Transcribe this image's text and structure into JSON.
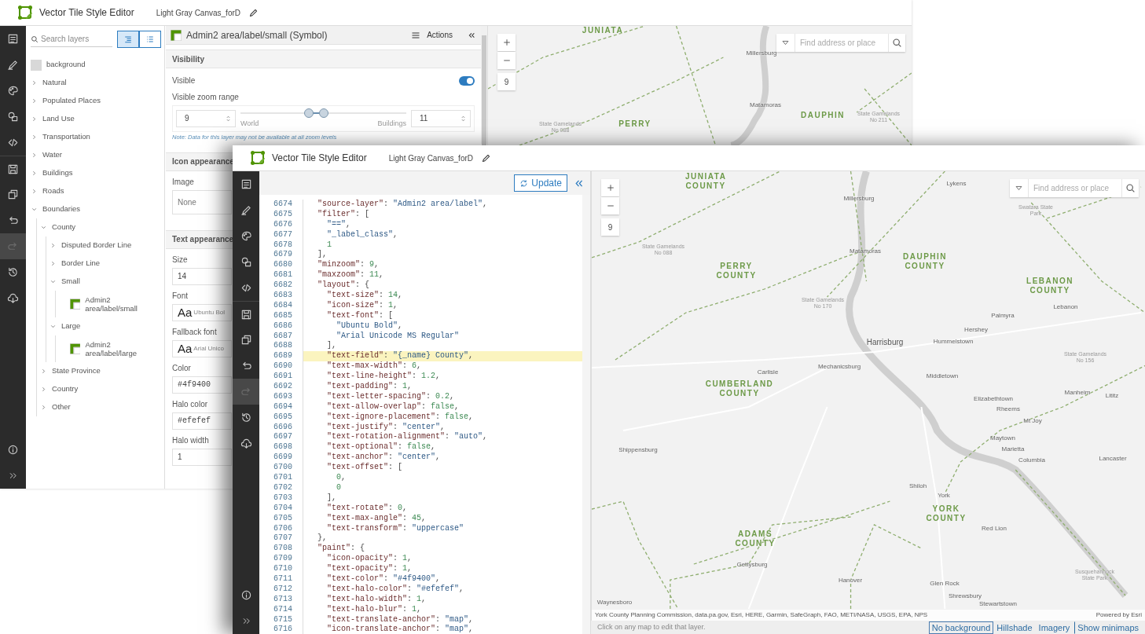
{
  "back_window": {
    "header": {
      "app_title": "Vector Tile Style Editor",
      "document_title": "Light Gray Canvas_forD"
    },
    "rail": [
      {
        "selected": false
      },
      {
        "selected": false
      },
      {
        "selected": false
      },
      {
        "selected": false
      },
      {
        "selected": false
      },
      {
        "selected": false
      },
      {
        "selected": false
      },
      {
        "selected": false
      },
      {
        "selected": true
      },
      {
        "selected": false
      },
      {
        "selected": false
      }
    ],
    "layers": {
      "search": {
        "placeholder": "Search layers"
      },
      "view_toggles": [
        {
          "selected": true
        },
        {
          "selected": false
        }
      ],
      "tree": [
        {
          "label": "background",
          "kind": "swatch"
        },
        {
          "label": "Natural",
          "kind": "group",
          "expanded": false
        },
        {
          "label": "Populated Places",
          "kind": "group",
          "expanded": false
        },
        {
          "label": "Land Use",
          "kind": "group",
          "expanded": false
        },
        {
          "label": "Transportation",
          "kind": "group",
          "expanded": false
        },
        {
          "label": "Water",
          "kind": "group",
          "expanded": false
        },
        {
          "label": "Buildings",
          "kind": "group",
          "expanded": false
        },
        {
          "label": "Roads",
          "kind": "group",
          "expanded": false
        },
        {
          "label": "Boundaries",
          "kind": "group",
          "expanded": true,
          "children": [
            {
              "label": "County",
              "kind": "group",
              "expanded": true,
              "children": [
                {
                  "label": "Disputed Border Line",
                  "kind": "group",
                  "expanded": false
                },
                {
                  "label": "Border Line",
                  "kind": "group",
                  "expanded": false
                },
                {
                  "label": "Small",
                  "kind": "group",
                  "expanded": true,
                  "children": [
                    {
                      "label": "Admin2 area/label/small",
                      "kind": "layer"
                    }
                  ]
                },
                {
                  "label": "Large",
                  "kind": "group",
                  "expanded": true,
                  "children": [
                    {
                      "label": "Admin2 area/label/large",
                      "kind": "layer"
                    }
                  ]
                }
              ]
            },
            {
              "label": "State Province",
              "kind": "group",
              "expanded": false
            },
            {
              "label": "Country",
              "kind": "group",
              "expanded": false
            },
            {
              "label": "Other",
              "kind": "group",
              "expanded": false
            }
          ]
        }
      ]
    },
    "properties": {
      "title": "Admin2 area/label/small (Symbol)",
      "actions": "Actions",
      "visibility": {
        "heading": "Visibility",
        "visible_label": "Visible",
        "visible_on": true,
        "range_label": "Visible zoom range",
        "min_zoom": "9",
        "max_zoom": "11",
        "slider_thumbs": [
          {
            "level": 0.41
          },
          {
            "level": 0.5
          }
        ],
        "min_caption": "World",
        "max_caption": "Buildings",
        "note": "Note: Data for this layer may not be available at all zoom levels"
      },
      "icon": {
        "heading": "Icon appearance",
        "image_label": "Image",
        "image_value": "None"
      },
      "text": {
        "heading": "Text appearance",
        "size_label": "Size",
        "size_value": "14",
        "font_label": "Font",
        "font_sample": "Aa",
        "font_value": "Ubuntu Bol",
        "fallback_label": "Fallback font",
        "fallback_sample": "Aa",
        "fallback_value": "Arial Unico",
        "color_label": "Color",
        "color_value": "#4f9400",
        "halo_color_label": "Halo color",
        "halo_color_value": "#efefef",
        "halo_width_label": "Halo width",
        "halo_width_value": "1"
      }
    },
    "map": {
      "zoom_level": "9",
      "search": {
        "placeholder": "Find address or place"
      },
      "labels": [
        {
          "text": "JUNIATA",
          "kind": "county"
        },
        {
          "text": "Millersburg",
          "kind": "city"
        },
        {
          "text": "State Gamelands No 088",
          "kind": "park"
        },
        {
          "text": "Matamoras",
          "kind": "city"
        },
        {
          "text": "DAUPHIN",
          "kind": "county"
        },
        {
          "text": "State Gamelands No 211",
          "kind": "park"
        },
        {
          "text": "PERRY",
          "kind": "county"
        }
      ]
    }
  },
  "front_window": {
    "header": {
      "app_title": "Vector Tile Style Editor",
      "document_title": "Light Gray Canvas_forD"
    },
    "rail": [
      {
        "selected": false
      },
      {
        "selected": false
      },
      {
        "selected": false
      },
      {
        "selected": false
      },
      {
        "selected": false
      },
      {
        "selected": false
      },
      {
        "selected": false
      },
      {
        "selected": false
      },
      {
        "selected": true
      },
      {
        "selected": false
      },
      {
        "selected": false
      }
    ],
    "editor": {
      "update_button": "Update",
      "lines": [
        {
          "number": "6674",
          "text": "  \"source-layer\": \"Admin2 area/label\",",
          "highlighted": false
        },
        {
          "number": "6675",
          "text": "  \"filter\": [",
          "highlighted": false
        },
        {
          "number": "6676",
          "text": "    \"==\",",
          "highlighted": false
        },
        {
          "number": "6677",
          "text": "    \"_label_class\",",
          "highlighted": false
        },
        {
          "number": "6678",
          "text": "    1",
          "highlighted": false
        },
        {
          "number": "6679",
          "text": "  ],",
          "highlighted": false
        },
        {
          "number": "6680",
          "text": "  \"minzoom\": 9,",
          "highlighted": false
        },
        {
          "number": "6681",
          "text": "  \"maxzoom\": 11,",
          "highlighted": false
        },
        {
          "number": "6682",
          "text": "  \"layout\": {",
          "highlighted": false
        },
        {
          "number": "6683",
          "text": "    \"text-size\": 14,",
          "highlighted": false
        },
        {
          "number": "6684",
          "text": "    \"icon-size\": 1,",
          "highlighted": false
        },
        {
          "number": "6685",
          "text": "    \"text-font\": [",
          "highlighted": false
        },
        {
          "number": "6686",
          "text": "      \"Ubuntu Bold\",",
          "highlighted": false
        },
        {
          "number": "6687",
          "text": "      \"Arial Unicode MS Regular\"",
          "highlighted": false
        },
        {
          "number": "6688",
          "text": "    ],",
          "highlighted": false
        },
        {
          "number": "6689",
          "text": "    \"text-field\": \"{_name} County\",",
          "highlighted": true
        },
        {
          "number": "6690",
          "text": "    \"text-max-width\": 6,",
          "highlighted": false
        },
        {
          "number": "6691",
          "text": "    \"text-line-height\": 1.2,",
          "highlighted": false
        },
        {
          "number": "6692",
          "text": "    \"text-padding\": 1,",
          "highlighted": false
        },
        {
          "number": "6693",
          "text": "    \"text-letter-spacing\": 0.2,",
          "highlighted": false
        },
        {
          "number": "6694",
          "text": "    \"text-allow-overlap\": false,",
          "highlighted": false
        },
        {
          "number": "6695",
          "text": "    \"text-ignore-placement\": false,",
          "highlighted": false
        },
        {
          "number": "6696",
          "text": "    \"text-justify\": \"center\",",
          "highlighted": false
        },
        {
          "number": "6697",
          "text": "    \"text-rotation-alignment\": \"auto\",",
          "highlighted": false
        },
        {
          "number": "6698",
          "text": "    \"text-optional\": false,",
          "highlighted": false
        },
        {
          "number": "6699",
          "text": "    \"text-anchor\": \"center\",",
          "highlighted": false
        },
        {
          "number": "6700",
          "text": "    \"text-offset\": [",
          "highlighted": false
        },
        {
          "number": "6701",
          "text": "      0,",
          "highlighted": false
        },
        {
          "number": "6702",
          "text": "      0",
          "highlighted": false
        },
        {
          "number": "6703",
          "text": "    ],",
          "highlighted": false
        },
        {
          "number": "6704",
          "text": "    \"text-rotate\": 0,",
          "highlighted": false
        },
        {
          "number": "6705",
          "text": "    \"text-max-angle\": 45,",
          "highlighted": false
        },
        {
          "number": "6706",
          "text": "    \"text-transform\": \"uppercase\"",
          "highlighted": false
        },
        {
          "number": "6707",
          "text": "  },",
          "highlighted": false
        },
        {
          "number": "6708",
          "text": "  \"paint\": {",
          "highlighted": false
        },
        {
          "number": "6709",
          "text": "    \"icon-opacity\": 1,",
          "highlighted": false
        },
        {
          "number": "6710",
          "text": "    \"text-opacity\": 1,",
          "highlighted": false
        },
        {
          "number": "6711",
          "text": "    \"text-color\": \"#4f9400\",",
          "highlighted": false
        },
        {
          "number": "6712",
          "text": "    \"text-halo-color\": \"#efefef\",",
          "highlighted": false
        },
        {
          "number": "6713",
          "text": "    \"text-halo-width\": 1,",
          "highlighted": false
        },
        {
          "number": "6714",
          "text": "    \"text-halo-blur\": 1,",
          "highlighted": false
        },
        {
          "number": "6715",
          "text": "    \"text-translate-anchor\": \"map\",",
          "highlighted": false
        },
        {
          "number": "6716",
          "text": "    \"icon-translate-anchor\": \"map\",",
          "highlighted": false
        }
      ]
    },
    "map": {
      "zoom_level": "9",
      "search": {
        "placeholder": "Find address or place"
      },
      "labels": [
        {
          "text": "JUNIATA COUNTY",
          "kind": "county"
        },
        {
          "text": "Lykens",
          "kind": "city"
        },
        {
          "text": "Millersburg",
          "kind": "city"
        },
        {
          "text": "Swatara State Park",
          "kind": "park"
        },
        {
          "text": "State Gamelands No 088",
          "kind": "park"
        },
        {
          "text": "Matamoras",
          "kind": "city"
        },
        {
          "text": "DAUPHIN COUNTY",
          "kind": "county"
        },
        {
          "text": "PERRY COUNTY",
          "kind": "county"
        },
        {
          "text": "LEBANON COUNTY",
          "kind": "county"
        },
        {
          "text": "Lebanon",
          "kind": "city"
        },
        {
          "text": "State Gamelands No 170",
          "kind": "park"
        },
        {
          "text": "Palmyra",
          "kind": "city"
        },
        {
          "text": "Hershey",
          "kind": "city"
        },
        {
          "text": "Harrisburg",
          "kind": "capital"
        },
        {
          "text": "Hummelstown",
          "kind": "city"
        },
        {
          "text": "State Gamelands No 156",
          "kind": "park"
        },
        {
          "text": "Mechanicsburg",
          "kind": "city"
        },
        {
          "text": "Carlisle",
          "kind": "city"
        },
        {
          "text": "CUMBERLAND COUNTY",
          "kind": "county"
        },
        {
          "text": "Middletown",
          "kind": "city"
        },
        {
          "text": "Manheim",
          "kind": "city"
        },
        {
          "text": "Lititz",
          "kind": "city"
        },
        {
          "text": "Elizabethtown",
          "kind": "city"
        },
        {
          "text": "Rheems",
          "kind": "city"
        },
        {
          "text": "Mt Joy",
          "kind": "city"
        },
        {
          "text": "Maytown",
          "kind": "city"
        },
        {
          "text": "Marietta",
          "kind": "city"
        },
        {
          "text": "Lancaster",
          "kind": "city"
        },
        {
          "text": "Columbia",
          "kind": "city"
        },
        {
          "text": "Shippensburg",
          "kind": "city"
        },
        {
          "text": "Shiloh",
          "kind": "city"
        },
        {
          "text": "York",
          "kind": "city"
        },
        {
          "text": "YORK COUNTY",
          "kind": "county"
        },
        {
          "text": "Red Lion",
          "kind": "city"
        },
        {
          "text": "ADAMS COUNTY",
          "kind": "county"
        },
        {
          "text": "Gettysburg",
          "kind": "city"
        },
        {
          "text": "Hanover",
          "kind": "city"
        },
        {
          "text": "Susquehannock State Park",
          "kind": "park"
        },
        {
          "text": "Glen Rock",
          "kind": "city"
        },
        {
          "text": "Shrewsbury",
          "kind": "city"
        },
        {
          "text": "Waynesboro",
          "kind": "city"
        },
        {
          "text": "Stewartstown",
          "kind": "city"
        }
      ],
      "attribution": "York County Planning Commission, data.pa.gov, Esri, HERE, Garmin, SafeGraph, FAO, METI/NASA, USGS, EPA, NPS",
      "powered_by": "Powered by Esri",
      "hint": "Click on any map to edit that layer.",
      "basemap_links": [
        {
          "label": "No background",
          "selected": true
        },
        {
          "label": "Hillshade",
          "selected": false
        },
        {
          "label": "Imagery",
          "selected": false
        },
        {
          "label": "Show minimaps",
          "selected": false
        }
      ]
    }
  }
}
